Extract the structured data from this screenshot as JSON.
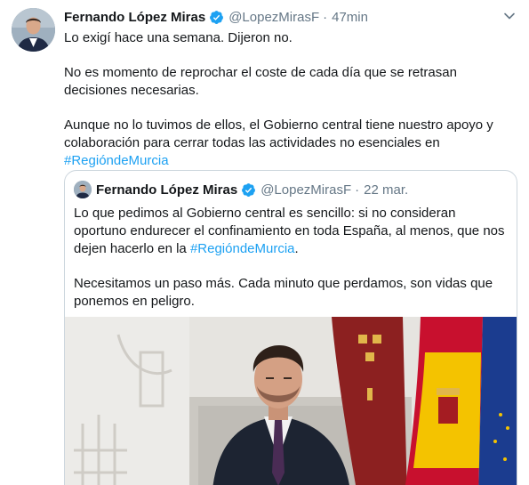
{
  "tweet": {
    "author_name": "Fernando López Miras",
    "handle": "@LopezMirasF",
    "separator": "·",
    "time": "47min",
    "paragraphs": [
      "Lo exigí hace una semana. Dijeron no.",
      "No es momento de reprochar el coste de cada día que se retrasan decisiones necesarias.",
      "Aunque no lo tuvimos de ellos, el Gobierno central tiene nuestro apoyo y colaboración para cerrar todas las actividades no esenciales en"
    ],
    "hashtag": "#RegióndeMurcia"
  },
  "quoted_tweet": {
    "author_name": "Fernando López Miras",
    "handle": "@LopezMirasF",
    "separator": "·",
    "time": "22 mar.",
    "paragraph1_text": "Lo que pedimos al Gobierno central es sencillo: si no consideran oportuno endurecer el confinamiento en toda España, al menos, que nos dejen hacerlo en la",
    "paragraph1_hashtag": "#RegióndeMurcia",
    "paragraph1_end": ".",
    "paragraph2": "Necesitamos un paso más. Cada minuto que perdamos, son vidas que ponemos en peligro."
  },
  "icons": {
    "verified": "verified-badge-icon",
    "more": "chevron-down-icon"
  },
  "colors": {
    "text": "#14171a",
    "secondary": "#657786",
    "link": "#1da1f2",
    "verified": "#1da1f2",
    "border": "#ccd6dd"
  }
}
